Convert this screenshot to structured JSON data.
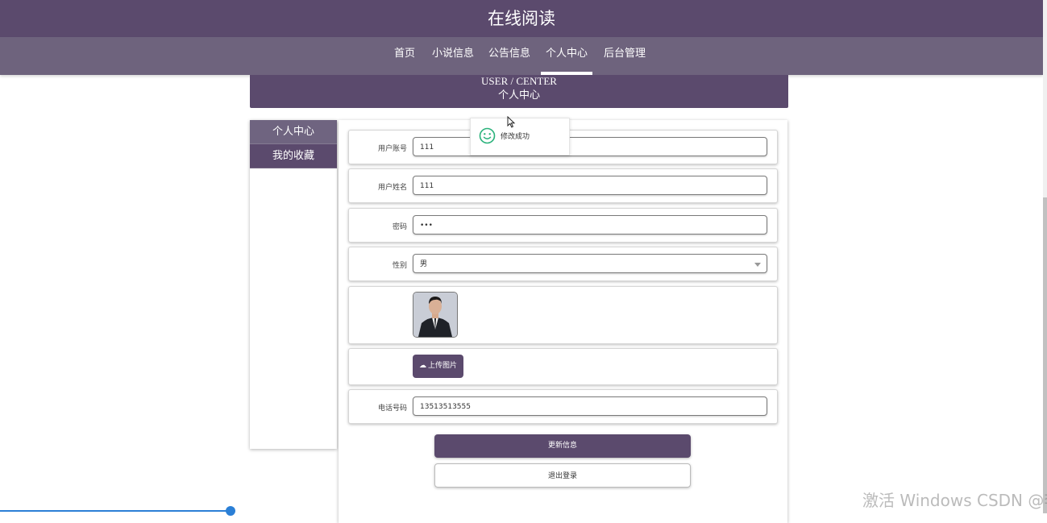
{
  "site": {
    "title": "在线阅读"
  },
  "nav": [
    {
      "label": "首页"
    },
    {
      "label": "小说信息"
    },
    {
      "label": "公告信息"
    },
    {
      "label": "个人中心"
    },
    {
      "label": "后台管理"
    }
  ],
  "banner": {
    "en": "USER / CENTER",
    "cn": "个人中心"
  },
  "sidebar": {
    "items": [
      {
        "label": "个人中心"
      },
      {
        "label": "我的收藏"
      }
    ]
  },
  "form": {
    "account": {
      "label": "用户账号",
      "value": "111"
    },
    "name": {
      "label": "用户姓名",
      "value": "111"
    },
    "password": {
      "label": "密码",
      "value": "•••"
    },
    "gender": {
      "label": "性别",
      "value": "男"
    },
    "upload": {
      "label": "上传图片"
    },
    "phone": {
      "label": "电话号码",
      "value": "13513513555"
    }
  },
  "buttons": {
    "update": "更新信息",
    "logout": "退出登录"
  },
  "toast": {
    "message": "修改成功"
  },
  "watermark": "激活 Windows CSDN @李子c",
  "colors": {
    "primary": "#5b4a6d",
    "nav": "#6e637d",
    "toast_icon": "#2ab27b"
  }
}
